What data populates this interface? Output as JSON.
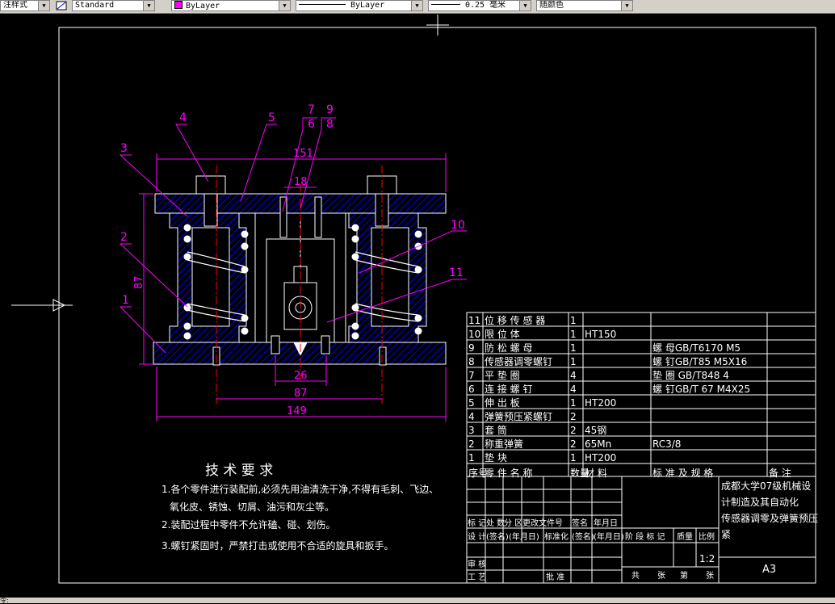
{
  "toolbar": {
    "text_style": "注样式",
    "dim_style": "Standard",
    "layer": "ByLayer",
    "linetype": "ByLayer",
    "lineweight": "0.25 毫米",
    "plot_style": "随颜色"
  },
  "status_bar": {
    "text": "令:"
  },
  "colors": {
    "background": "#000000",
    "frame": "#ffffff",
    "dimension": "#ff00ff",
    "part_fill": "#0000ff",
    "center_line": "#ff0000",
    "leader": "#ff00ff"
  },
  "drawing": {
    "balloons": [
      "1",
      "2",
      "3",
      "4",
      "5",
      "6",
      "7",
      "8",
      "9",
      "10",
      "11"
    ],
    "dimensions": {
      "top_width": "151",
      "inner_width": "18",
      "height": "87",
      "bottom_small": "26",
      "bottom_mid": "87",
      "bottom_total": "149"
    }
  },
  "tech_requirements": {
    "title": "技 术 要 求",
    "items": [
      "1.各个零件进行装配前,必须先用油清洗干净,不得有毛刺、飞边、",
      "氧化皮、锈蚀、切屑、油污和灰尘等。",
      "2.装配过程中零件不允许磕、碰、划伤。",
      "3.螺钉紧固时，严禁打击或使用不合适的旋具和扳手。"
    ]
  },
  "parts_list": {
    "rows": [
      {
        "no": "11",
        "name": "位 移 传 感 器",
        "qty": "1",
        "material": "",
        "standard": "",
        "note": ""
      },
      {
        "no": "10",
        "name": "限 位 体",
        "qty": "1",
        "material": "HT150",
        "standard": "",
        "note": ""
      },
      {
        "no": "9",
        "name": "防 松 螺 母",
        "qty": "1",
        "material": "",
        "standard": "螺 母GB/T6170 M5",
        "note": ""
      },
      {
        "no": "8",
        "name": "传感器调零螺钉",
        "qty": "1",
        "material": "",
        "standard": "螺 钉GB/T85 M5X16",
        "note": ""
      },
      {
        "no": "7",
        "name": "平 垫 圈",
        "qty": "4",
        "material": "",
        "standard": "垫 圈 GB/T848  4",
        "note": ""
      },
      {
        "no": "6",
        "name": "连 接 螺 钉",
        "qty": "4",
        "material": "",
        "standard": "螺 钉GB/T 67 M4X25",
        "note": ""
      },
      {
        "no": "5",
        "name": "伸 出 板",
        "qty": "1",
        "material": "HT200",
        "standard": "",
        "note": ""
      },
      {
        "no": "4",
        "name": "弹簧预压紧螺钉",
        "qty": "2",
        "material": "",
        "standard": "",
        "note": ""
      },
      {
        "no": "3",
        "name": "套 筒",
        "qty": "2",
        "material": "45钢",
        "standard": "",
        "note": ""
      },
      {
        "no": "2",
        "name": "称重弹簧",
        "qty": "2",
        "material": "65Mn",
        "standard": "RC3/8",
        "note": ""
      },
      {
        "no": "1",
        "name": "垫 块",
        "qty": "1",
        "material": "HT200",
        "standard": "",
        "note": ""
      }
    ],
    "header": {
      "no": "序号",
      "name": "零 件 名 称",
      "qty": "数量",
      "material": "材  料",
      "standard": "标 准 及 规 格",
      "note": "备   注"
    }
  },
  "title_block": {
    "company": [
      "成都大学07级机械设",
      "计制造及其自动化"
    ],
    "drawing_name": [
      "传感器调零及弹簧预压",
      "紧"
    ],
    "scale": "1:2",
    "sheet_size": "A3",
    "revision_labels": [
      "标 记",
      "处 数",
      "分 区",
      "更改文件号",
      "签名",
      "年月日"
    ],
    "design_labels": [
      "设 计",
      "(签名)",
      "(年月日)",
      "标准化",
      "(签名)",
      "(年月日)"
    ],
    "stage_labels": [
      "阶 段 标 记",
      "质量",
      "比例"
    ],
    "review_label": "审 核",
    "process_label": "工 艺",
    "approve_label": "批 准",
    "sheet_labels": [
      "共",
      "张",
      "第",
      "张"
    ]
  }
}
